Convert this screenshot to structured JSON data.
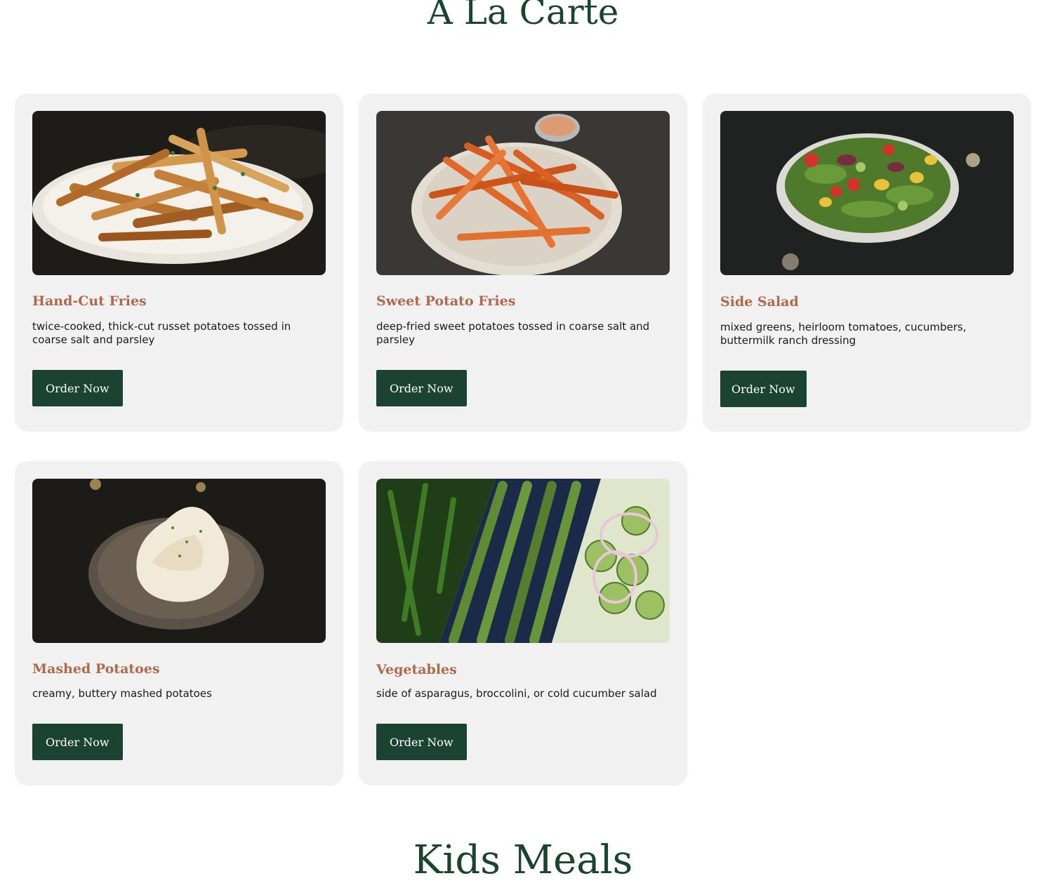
{
  "sections": {
    "a_la_carte_title": "A La Carte",
    "kids_meals_title": "Kids Meals"
  },
  "menu_items": [
    {
      "name": "Hand-Cut Fries",
      "description": "twice-cooked, thick-cut russet potatoes tossed in coarse salt and parsley",
      "button": "Order Now"
    },
    {
      "name": "Sweet Potato Fries",
      "description": "deep-fried sweet potatoes tossed in coarse salt and parsley",
      "button": "Order Now"
    },
    {
      "name": "Side Salad",
      "description": "mixed greens, heirloom tomatoes, cucumbers, buttermilk ranch dressing",
      "button": "Order Now"
    },
    {
      "name": "Mashed Potatoes",
      "description": "creamy, buttery mashed potatoes",
      "button": "Order Now"
    },
    {
      "name": "Vegetables",
      "description": "side of asparagus, broccolini, or cold cucumber salad",
      "button": "Order Now"
    }
  ],
  "colors": {
    "heading_green": "#1b4332",
    "item_name_brown": "#b0694a",
    "card_background": "#f1f1f1",
    "button_background": "#1b4332"
  }
}
